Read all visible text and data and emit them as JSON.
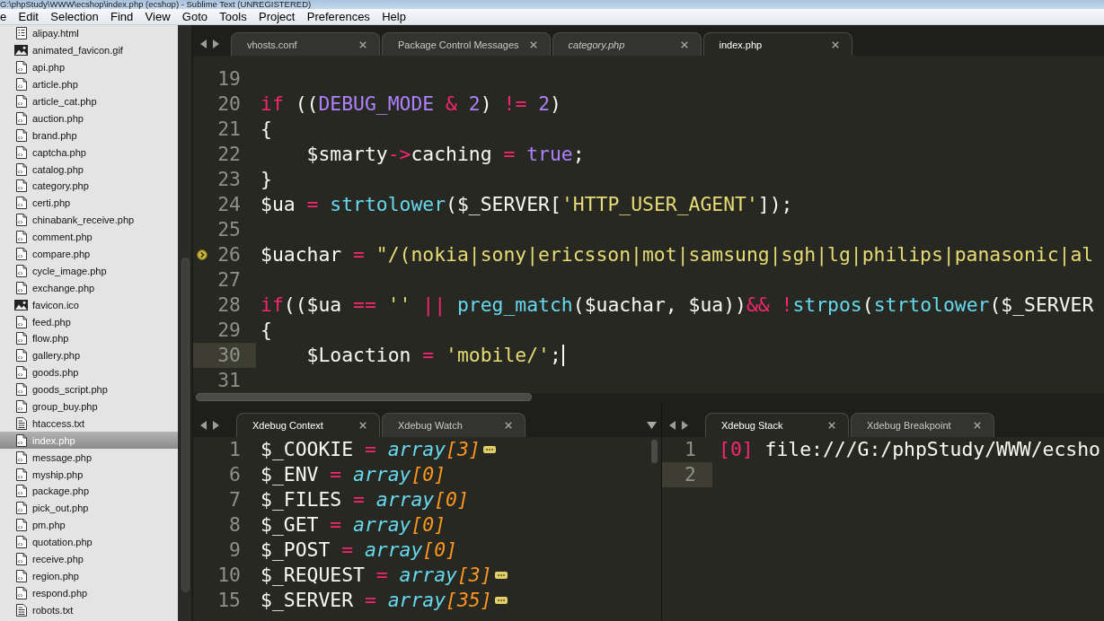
{
  "window": {
    "title": "G:\\phpStudy\\WWW\\ecshop\\index.php (ecshop) - Sublime Text (UNREGISTERED)"
  },
  "menu_bar": [
    "e",
    "Edit",
    "Selection",
    "Find",
    "View",
    "Goto",
    "Tools",
    "Project",
    "Preferences",
    "Help"
  ],
  "sidebar": {
    "items": [
      {
        "name": "alipay.html",
        "kind": "html",
        "selected": false
      },
      {
        "name": "animated_favicon.gif",
        "kind": "image",
        "selected": false
      },
      {
        "name": "api.php",
        "kind": "php",
        "selected": false
      },
      {
        "name": "article.php",
        "kind": "php",
        "selected": false
      },
      {
        "name": "article_cat.php",
        "kind": "php",
        "selected": false
      },
      {
        "name": "auction.php",
        "kind": "php",
        "selected": false
      },
      {
        "name": "brand.php",
        "kind": "php",
        "selected": false
      },
      {
        "name": "captcha.php",
        "kind": "php",
        "selected": false
      },
      {
        "name": "catalog.php",
        "kind": "php",
        "selected": false
      },
      {
        "name": "category.php",
        "kind": "php",
        "selected": false
      },
      {
        "name": "certi.php",
        "kind": "php",
        "selected": false
      },
      {
        "name": "chinabank_receive.php",
        "kind": "php",
        "selected": false
      },
      {
        "name": "comment.php",
        "kind": "php",
        "selected": false
      },
      {
        "name": "compare.php",
        "kind": "php",
        "selected": false
      },
      {
        "name": "cycle_image.php",
        "kind": "php",
        "selected": false
      },
      {
        "name": "exchange.php",
        "kind": "php",
        "selected": false
      },
      {
        "name": "favicon.ico",
        "kind": "image",
        "selected": false
      },
      {
        "name": "feed.php",
        "kind": "php",
        "selected": false
      },
      {
        "name": "flow.php",
        "kind": "php",
        "selected": false
      },
      {
        "name": "gallery.php",
        "kind": "php",
        "selected": false
      },
      {
        "name": "goods.php",
        "kind": "php",
        "selected": false
      },
      {
        "name": "goods_script.php",
        "kind": "php",
        "selected": false
      },
      {
        "name": "group_buy.php",
        "kind": "php",
        "selected": false
      },
      {
        "name": "htaccess.txt",
        "kind": "text",
        "selected": false
      },
      {
        "name": "index.php",
        "kind": "php",
        "selected": true
      },
      {
        "name": "message.php",
        "kind": "php",
        "selected": false
      },
      {
        "name": "myship.php",
        "kind": "php",
        "selected": false
      },
      {
        "name": "package.php",
        "kind": "php",
        "selected": false
      },
      {
        "name": "pick_out.php",
        "kind": "php",
        "selected": false
      },
      {
        "name": "pm.php",
        "kind": "php",
        "selected": false
      },
      {
        "name": "quotation.php",
        "kind": "php",
        "selected": false
      },
      {
        "name": "receive.php",
        "kind": "php",
        "selected": false
      },
      {
        "name": "region.php",
        "kind": "php",
        "selected": false
      },
      {
        "name": "respond.php",
        "kind": "php",
        "selected": false
      },
      {
        "name": "robots.txt",
        "kind": "text",
        "selected": false
      }
    ]
  },
  "editor": {
    "focused": true,
    "tabs": [
      {
        "label": "vhosts.conf",
        "selected": false,
        "preview": false
      },
      {
        "label": "Package Control Messages",
        "selected": false,
        "preview": false
      },
      {
        "label": "category.php",
        "selected": false,
        "preview": true
      },
      {
        "label": "index.php",
        "selected": true,
        "preview": false
      }
    ],
    "lines": [
      {
        "number": "19",
        "current": false,
        "marker": false
      },
      {
        "number": "20",
        "current": false,
        "marker": false,
        "tokens": [
          {
            "text": "if",
            "kind": "keyword"
          },
          {
            "text": " ((",
            "kind": "plain"
          },
          {
            "text": "DEBUG_MODE",
            "kind": "constant"
          },
          {
            "text": " & ",
            "kind": "operator"
          },
          {
            "text": "2",
            "kind": "constant"
          },
          {
            "text": ") ",
            "kind": "plain"
          },
          {
            "text": "!= ",
            "kind": "operator"
          },
          {
            "text": "2",
            "kind": "constant"
          },
          {
            "text": ")",
            "kind": "plain"
          }
        ]
      },
      {
        "number": "21",
        "current": false,
        "marker": false,
        "tokens": [
          {
            "text": "{",
            "kind": "plain"
          }
        ]
      },
      {
        "number": "22",
        "current": false,
        "marker": false,
        "tokens": [
          {
            "text": "    $smarty",
            "kind": "plain"
          },
          {
            "text": "->",
            "kind": "operator"
          },
          {
            "text": "caching ",
            "kind": "plain"
          },
          {
            "text": "= ",
            "kind": "operator"
          },
          {
            "text": "true",
            "kind": "constant"
          },
          {
            "text": ";",
            "kind": "plain"
          }
        ]
      },
      {
        "number": "23",
        "current": false,
        "marker": false,
        "tokens": [
          {
            "text": "}",
            "kind": "plain"
          }
        ]
      },
      {
        "number": "24",
        "current": false,
        "marker": false,
        "tokens": [
          {
            "text": "$ua ",
            "kind": "plain"
          },
          {
            "text": "= ",
            "kind": "operator"
          },
          {
            "text": "strtolower",
            "kind": "function"
          },
          {
            "text": "($_SERVER[",
            "kind": "plain"
          },
          {
            "text": "'HTTP_USER_AGENT'",
            "kind": "string"
          },
          {
            "text": "]);",
            "kind": "plain"
          }
        ]
      },
      {
        "number": "25",
        "current": false,
        "marker": false
      },
      {
        "number": "26",
        "current": false,
        "marker": true,
        "tokens": [
          {
            "text": "$uachar ",
            "kind": "plain"
          },
          {
            "text": "= ",
            "kind": "operator"
          },
          {
            "text": "\"/(nokia|sony|ericsson|mot|samsung|sgh|lg|philips|panasonic|al",
            "kind": "string"
          }
        ]
      },
      {
        "number": "27",
        "current": false,
        "marker": false
      },
      {
        "number": "28",
        "current": false,
        "marker": false,
        "tokens": [
          {
            "text": "if",
            "kind": "keyword"
          },
          {
            "text": "(($ua ",
            "kind": "plain"
          },
          {
            "text": "== ",
            "kind": "operator"
          },
          {
            "text": "''",
            "kind": "string"
          },
          {
            "text": " || ",
            "kind": "operator"
          },
          {
            "text": "preg_match",
            "kind": "function"
          },
          {
            "text": "($uachar, $ua))",
            "kind": "plain"
          },
          {
            "text": "&& !",
            "kind": "operator"
          },
          {
            "text": "strpos",
            "kind": "function"
          },
          {
            "text": "(",
            "kind": "plain"
          },
          {
            "text": "strtolower",
            "kind": "function"
          },
          {
            "text": "($_SERVER",
            "kind": "plain"
          }
        ]
      },
      {
        "number": "29",
        "current": false,
        "marker": false,
        "tokens": [
          {
            "text": "{",
            "kind": "plain"
          }
        ]
      },
      {
        "number": "30",
        "current": true,
        "marker": false,
        "tokens": [
          {
            "text": "    $Loaction ",
            "kind": "plain"
          },
          {
            "text": "= ",
            "kind": "operator"
          },
          {
            "text": "'mobile/'",
            "kind": "string"
          },
          {
            "text": ";",
            "kind": "plain"
          }
        ]
      },
      {
        "number": "31",
        "current": false,
        "marker": false
      }
    ]
  },
  "panels": [
    {
      "tab_menu": true,
      "scrollbar": true,
      "focused": false,
      "tabs": [
        {
          "label": "Xdebug Context",
          "selected": true
        },
        {
          "label": "Xdebug Watch",
          "selected": false
        }
      ],
      "lines": [
        {
          "number": "1",
          "current": false,
          "folded": true,
          "tokens": [
            {
              "text": "$_COOKIE ",
              "kind": "plain"
            },
            {
              "text": "= ",
              "kind": "operator"
            },
            {
              "text": "array",
              "kind": "type"
            },
            {
              "text": "[3]",
              "kind": "size"
            }
          ]
        },
        {
          "number": "6",
          "current": false,
          "folded": false,
          "tokens": [
            {
              "text": "$_ENV ",
              "kind": "plain"
            },
            {
              "text": "= ",
              "kind": "operator"
            },
            {
              "text": "array",
              "kind": "type"
            },
            {
              "text": "[0]",
              "kind": "size"
            }
          ]
        },
        {
          "number": "7",
          "current": false,
          "folded": false,
          "tokens": [
            {
              "text": "$_FILES ",
              "kind": "plain"
            },
            {
              "text": "= ",
              "kind": "operator"
            },
            {
              "text": "array",
              "kind": "type"
            },
            {
              "text": "[0]",
              "kind": "size"
            }
          ]
        },
        {
          "number": "8",
          "current": false,
          "folded": false,
          "tokens": [
            {
              "text": "$_GET ",
              "kind": "plain"
            },
            {
              "text": "= ",
              "kind": "operator"
            },
            {
              "text": "array",
              "kind": "type"
            },
            {
              "text": "[0]",
              "kind": "size"
            }
          ]
        },
        {
          "number": "9",
          "current": false,
          "folded": false,
          "tokens": [
            {
              "text": "$_POST ",
              "kind": "plain"
            },
            {
              "text": "= ",
              "kind": "operator"
            },
            {
              "text": "array",
              "kind": "type"
            },
            {
              "text": "[0]",
              "kind": "size"
            }
          ]
        },
        {
          "number": "10",
          "current": false,
          "folded": true,
          "tokens": [
            {
              "text": "$_REQUEST ",
              "kind": "plain"
            },
            {
              "text": "= ",
              "kind": "operator"
            },
            {
              "text": "array",
              "kind": "type"
            },
            {
              "text": "[3]",
              "kind": "size"
            }
          ]
        },
        {
          "number": "15",
          "current": false,
          "folded": true,
          "tokens": [
            {
              "text": "$_SERVER ",
              "kind": "plain"
            },
            {
              "text": "= ",
              "kind": "operator"
            },
            {
              "text": "array",
              "kind": "type"
            },
            {
              "text": "[35]",
              "kind": "size"
            }
          ]
        }
      ]
    },
    {
      "tab_menu": false,
      "scrollbar": false,
      "focused": false,
      "tabs": [
        {
          "label": "Xdebug Stack",
          "selected": true
        },
        {
          "label": "Xdebug Breakpoint",
          "selected": false
        }
      ],
      "lines": [
        {
          "number": "1",
          "current": false,
          "folded": false,
          "tokens": [
            {
              "text": "[0]",
              "kind": "operator"
            },
            {
              "text": " file:///G:/phpStudy/WWW/ecsho",
              "kind": "plain"
            }
          ]
        },
        {
          "number": "2",
          "current": true,
          "folded": false
        }
      ]
    }
  ]
}
